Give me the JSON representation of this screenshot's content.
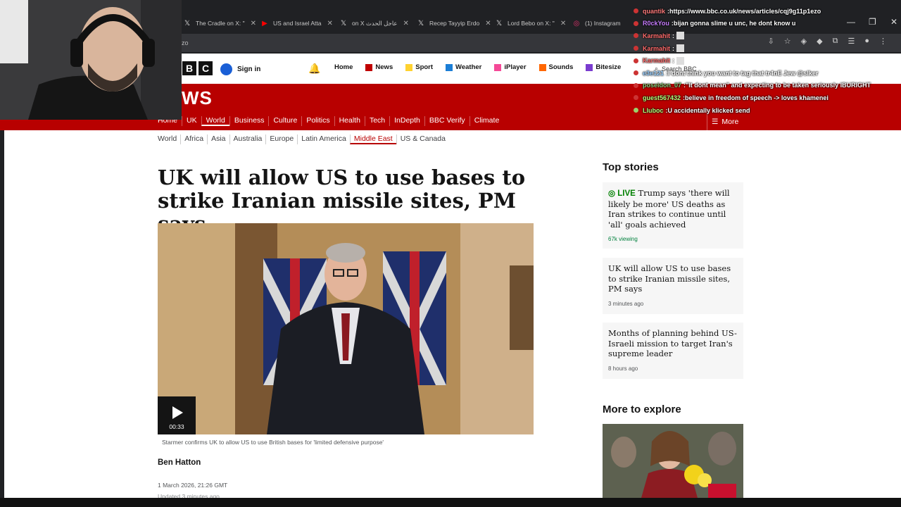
{
  "browser": {
    "tabs": [
      {
        "icon": "x-icon",
        "title": "The Cradle on X: \""
      },
      {
        "icon": "youtube-icon",
        "title": "US and Israel Atta"
      },
      {
        "icon": "x-icon",
        "title": "on X عاجل الحدث"
      },
      {
        "icon": "x-icon",
        "title": "Recep Tayyip Erdo"
      },
      {
        "icon": "x-icon",
        "title": "Lord Bebo on X: \""
      },
      {
        "icon": "instagram-icon",
        "title": "(1) Instagram"
      }
    ],
    "address_fragment": "zo"
  },
  "bbc_nav": {
    "logo_letters": [
      "B",
      "B",
      "C"
    ],
    "signin": "Sign in",
    "items": [
      {
        "label": "Home",
        "icon": "",
        "color": ""
      },
      {
        "label": "News",
        "icon": "news-icon",
        "color": "#c00000"
      },
      {
        "label": "Sport",
        "icon": "sport-icon",
        "color": "#ffd230"
      },
      {
        "label": "Weather",
        "icon": "weather-icon",
        "color": "#1c7ed6"
      },
      {
        "label": "iPlayer",
        "icon": "iplayer-icon",
        "color": "#f54997"
      },
      {
        "label": "Sounds",
        "icon": "sounds-icon",
        "color": "#ff6600"
      },
      {
        "label": "Bitesize",
        "icon": "bitesize-icon",
        "color": "#7a3ccf"
      }
    ],
    "search": "Search BBC"
  },
  "news_header": {
    "word": "WS",
    "sections": [
      "Home",
      "UK",
      "World",
      "Business",
      "Culture",
      "Politics",
      "Health",
      "Tech",
      "InDepth",
      "BBC Verify",
      "Climate"
    ],
    "active_section": "World",
    "more": "More"
  },
  "subnav": {
    "items": [
      "World",
      "Africa",
      "Asia",
      "Australia",
      "Europe",
      "Latin America",
      "Middle East",
      "US & Canada"
    ],
    "active": "Middle East"
  },
  "article": {
    "headline": "UK will allow US to use bases to strike Iranian missile sites, PM says",
    "video_duration": "00:33",
    "caption": "Starmer confirms UK to allow US to use British bases for 'limited defensive purpose'",
    "author": "Ben Hatton",
    "date": "1 March 2026, 21:26 GMT",
    "updated": "Updated 3 minutes ago"
  },
  "sidebar": {
    "top_stories_heading": "Top stories",
    "stories": [
      {
        "live": "LIVE",
        "title": "Trump says 'there will likely be more' US deaths as Iran strikes to continue until 'all' goals achieved",
        "meta": "67k viewing"
      },
      {
        "live": "",
        "title": "UK will allow US to use bases to strike Iranian missile sites, PM says",
        "meta": "3 minutes ago"
      },
      {
        "live": "",
        "title": "Months of planning behind US-Israeli mission to target Iran's supreme leader",
        "meta": "8 hours ago"
      }
    ],
    "more_to_explore_heading": "More to explore"
  },
  "chat": [
    {
      "user": "quantik",
      "color": "#ff7b7b",
      "msg": "https://www.bbc.co.uk/news/articles/cqj9g11p1ezo"
    },
    {
      "user": "R0ckYou",
      "color": "#c77dff",
      "msg": "bijan gonna slime u unc, he dont know u"
    },
    {
      "user": "Karmahit",
      "color": "#ff6b6b",
      "msg": ""
    },
    {
      "user": "Karmahit",
      "color": "#ff6b6b",
      "msg": ""
    },
    {
      "user": "Karmahit",
      "color": "#ff6b6b",
      "msg": ""
    },
    {
      "user": "e3e121",
      "color": "#9ad0ff",
      "msg": "I dont think you want to tag that tr4nE Jew @slker"
    },
    {
      "user": "poseidon_07",
      "color": "#7fd37f",
      "msg": "\"It dont mean\" and expecting to be taken seriously IBURIGHT"
    },
    {
      "user": "guest567432",
      "color": "#b0ff7a",
      "msg": "believe in freedom of speech -> loves khamenei"
    },
    {
      "user": "Lluboc",
      "color": "#b0ff7a",
      "msg": "U accidentally klicked send"
    }
  ]
}
